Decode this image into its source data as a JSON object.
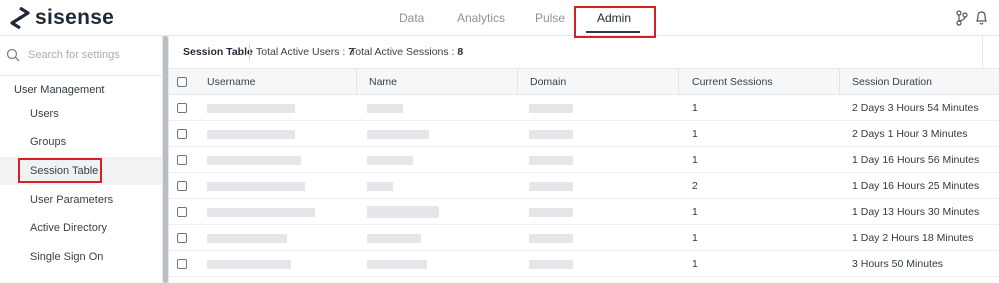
{
  "brand": {
    "name": "sisense"
  },
  "nav": {
    "tabs": [
      "Data",
      "Analytics",
      "Pulse",
      "Admin"
    ],
    "active": "Admin"
  },
  "sidebar": {
    "search_placeholder": "Search for settings",
    "section": "User Management",
    "items": [
      "Users",
      "Groups",
      "Session Table",
      "User Parameters",
      "Active Directory",
      "Single Sign On"
    ],
    "active_item": "Session Table"
  },
  "toolbar": {
    "title": "Session Table",
    "active_users_label": "Total Active Users :",
    "active_users_value": "7",
    "active_sessions_label": "Total Active Sessions :",
    "active_sessions_value": "8"
  },
  "table": {
    "columns": [
      "Username",
      "Name",
      "Domain",
      "Current Sessions",
      "Session Duration"
    ],
    "rows": [
      {
        "sessions": "1",
        "duration": "2 Days 3 Hours 54 Minutes"
      },
      {
        "sessions": "1",
        "duration": "2 Days 1 Hour 3 Minutes"
      },
      {
        "sessions": "1",
        "duration": "1 Day 16 Hours 56 Minutes"
      },
      {
        "sessions": "2",
        "duration": "1 Day 16 Hours 25 Minutes"
      },
      {
        "sessions": "1",
        "duration": "1 Day 13 Hours 30 Minutes"
      },
      {
        "sessions": "1",
        "duration": "1 Day 2 Hours 18 Minutes"
      },
      {
        "sessions": "1",
        "duration": "3 Hours 50 Minutes"
      }
    ]
  },
  "colors": {
    "highlight": "#d31f26",
    "text": "#2f3a45"
  },
  "icons": [
    "sisense-logo-icon",
    "search-icon",
    "branch-icon",
    "bell-icon"
  ]
}
